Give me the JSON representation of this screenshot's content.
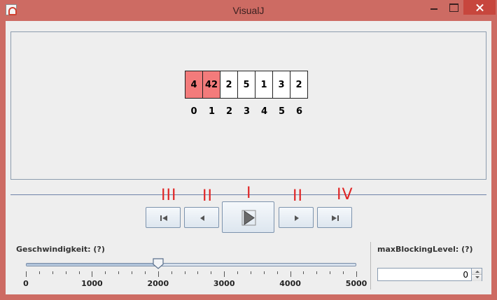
{
  "window": {
    "title": "VisualJ",
    "icon": "java-cup-icon"
  },
  "array": {
    "values": [
      "4",
      "42",
      "2",
      "5",
      "1",
      "3",
      "2"
    ],
    "indices": [
      "0",
      "1",
      "2",
      "3",
      "4",
      "5",
      "6"
    ],
    "highlight_color": "#f37b7b"
  },
  "controls": {
    "annotations": {
      "first": "III",
      "previous": "II",
      "play": "I",
      "next": "II",
      "last": "IV"
    },
    "icons": {
      "first": "skip-to-start-icon",
      "previous": "step-back-icon",
      "play": "play-icon",
      "next": "step-forward-icon",
      "last": "skip-to-end-icon"
    }
  },
  "speed": {
    "label": "Geschwindigkeit: (?)",
    "min": 0,
    "max": 5000,
    "value": 2000,
    "major_ticks": [
      "0",
      "1000",
      "2000",
      "3000",
      "4000",
      "5000"
    ]
  },
  "blocking": {
    "label": "maxBlockingLevel: (?)",
    "value": "0"
  },
  "colors": {
    "titlebar": "#cd6b63",
    "close_button": "#c7463d",
    "annotation": "#e02424"
  }
}
